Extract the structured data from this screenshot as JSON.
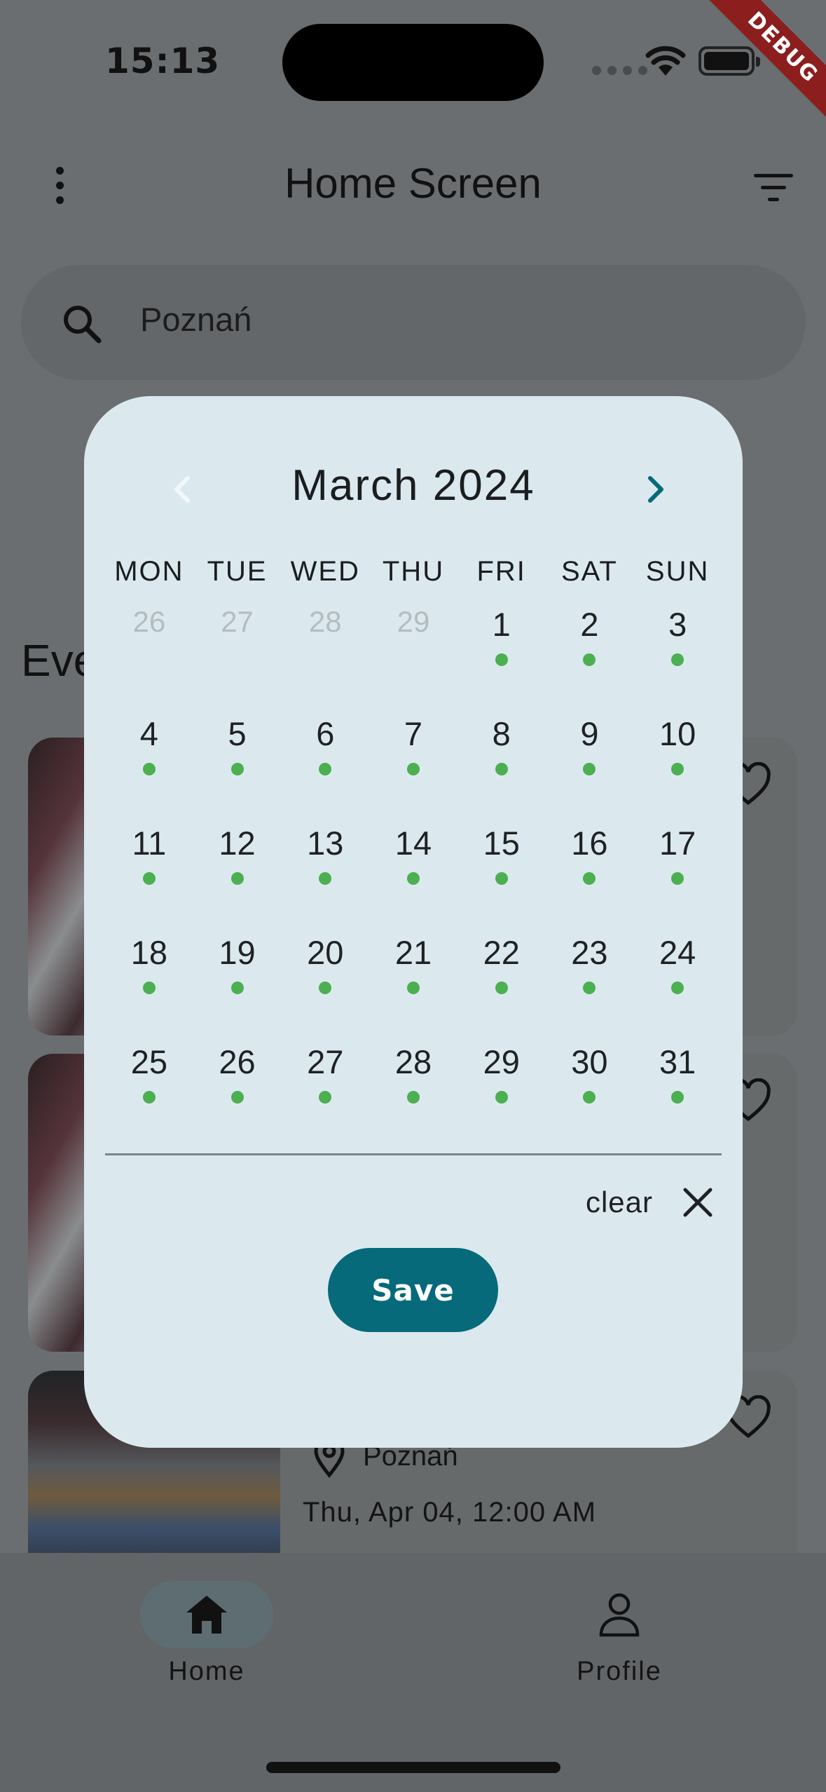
{
  "status_bar": {
    "time": "15:13",
    "debug_label": "DEBUG"
  },
  "app_bar": {
    "title": "Home Screen",
    "menu_icon": "more-vert-icon",
    "filter_icon": "filter-icon"
  },
  "search": {
    "value": "Poznań",
    "icon": "search-icon"
  },
  "section": {
    "heading_partial": "Eve"
  },
  "cards": [
    {
      "image": "cycling-photo",
      "heart_icon": "heart-outline-icon"
    },
    {
      "image": "cycling-photo",
      "heart_icon": "heart-outline-icon"
    },
    {
      "image": "expo-hall-photo",
      "location": "Poznań",
      "date": "Thu, Apr 04, 12:00 AM",
      "heart_icon": "heart-outline-icon"
    }
  ],
  "bottom_nav": {
    "items": [
      {
        "label": "Home",
        "icon": "home-icon",
        "active": true
      },
      {
        "label": "Profile",
        "icon": "person-icon",
        "active": false
      }
    ]
  },
  "calendar": {
    "month_title": "March 2024",
    "weekdays": [
      "MON",
      "TUE",
      "WED",
      "THU",
      "FRI",
      "SAT",
      "SUN"
    ],
    "outside_days": [
      "26",
      "27",
      "28",
      "29"
    ],
    "days": [
      "1",
      "2",
      "3",
      "4",
      "5",
      "6",
      "7",
      "8",
      "9",
      "10",
      "11",
      "12",
      "13",
      "14",
      "15",
      "16",
      "17",
      "18",
      "19",
      "20",
      "21",
      "22",
      "23",
      "24",
      "25",
      "26",
      "27",
      "28",
      "29",
      "30",
      "31"
    ],
    "days_with_events": [
      1,
      2,
      3,
      4,
      5,
      6,
      7,
      8,
      9,
      10,
      11,
      12,
      13,
      14,
      15,
      16,
      17,
      18,
      19,
      20,
      21,
      22,
      23,
      24,
      25,
      26,
      27,
      28,
      29,
      30,
      31
    ],
    "clear_label": "clear",
    "save_label": "Save",
    "colors": {
      "dialog_bg": "#dbe9ef",
      "accent": "#066a7a",
      "event_dot": "#4caf50",
      "outside_day": "#b5bcbf"
    }
  }
}
